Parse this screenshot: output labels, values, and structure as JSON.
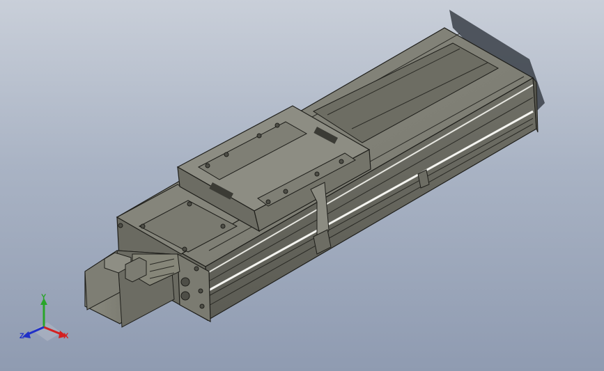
{
  "viewport": {
    "background_top": "#c9cfd9",
    "background_bottom": "#8f9bb1",
    "model_color": "#7d7d72",
    "shadow_color": "#3a3f48"
  },
  "triad": {
    "x_label": "X",
    "y_label": "Y",
    "z_label": "Z",
    "x_color": "#d42020",
    "y_color": "#2aa52a",
    "z_color": "#2030c8"
  }
}
